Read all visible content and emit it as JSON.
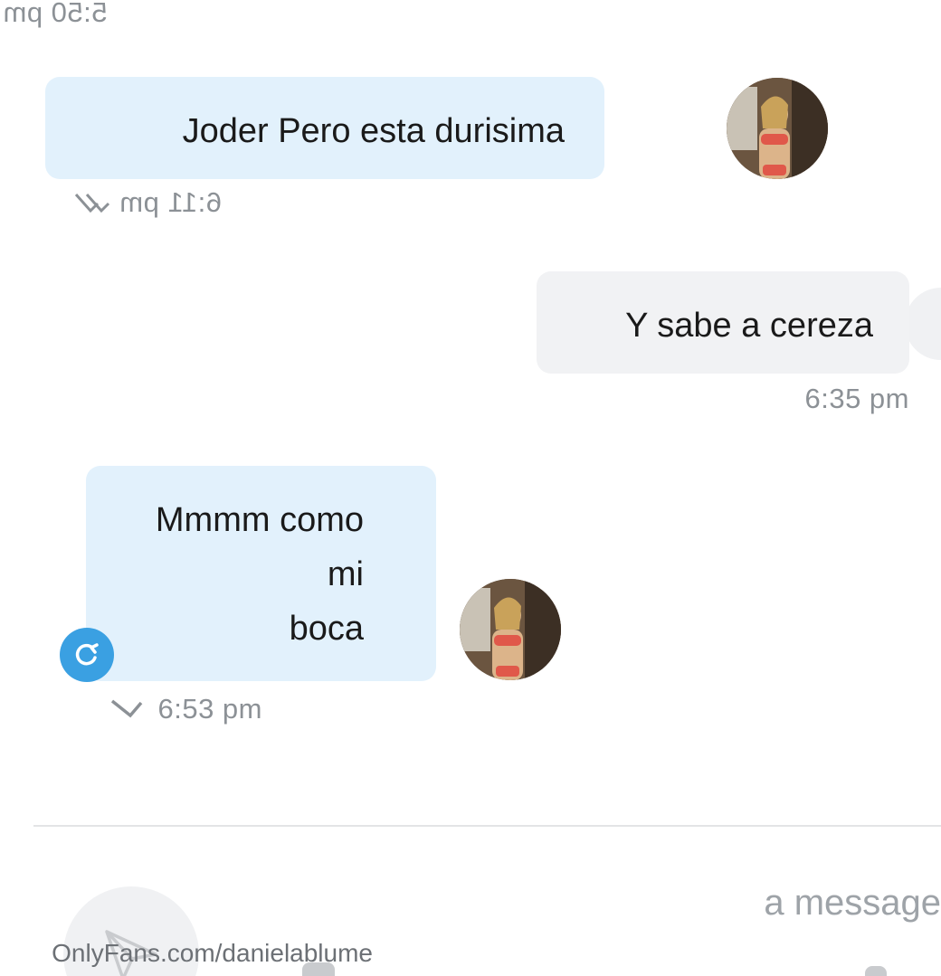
{
  "messages": [
    {
      "direction": "outgoing",
      "text": "",
      "time": "5:50 pm"
    },
    {
      "direction": "incoming",
      "text": "Joder Pero esta durisima",
      "time": "6:11 pm",
      "status": "read-double-check"
    },
    {
      "direction": "outgoing",
      "text": "Y sabe a cereza",
      "time": "6:35 pm"
    },
    {
      "direction": "incoming",
      "lines": [
        "Mmmm como",
        "mi",
        "boca"
      ],
      "time": "6:53 pm",
      "status": "sent-single-check",
      "badge": "tip-refresh-icon"
    }
  ],
  "composer": {
    "placeholder": "a message"
  },
  "watermark": "OnlyFans.com/danielablume",
  "colors": {
    "incoming_bubble": "#e2f1fc",
    "outgoing_bubble": "#f1f2f4",
    "badge": "#3aa0e2",
    "meta_text": "#8c9196"
  }
}
